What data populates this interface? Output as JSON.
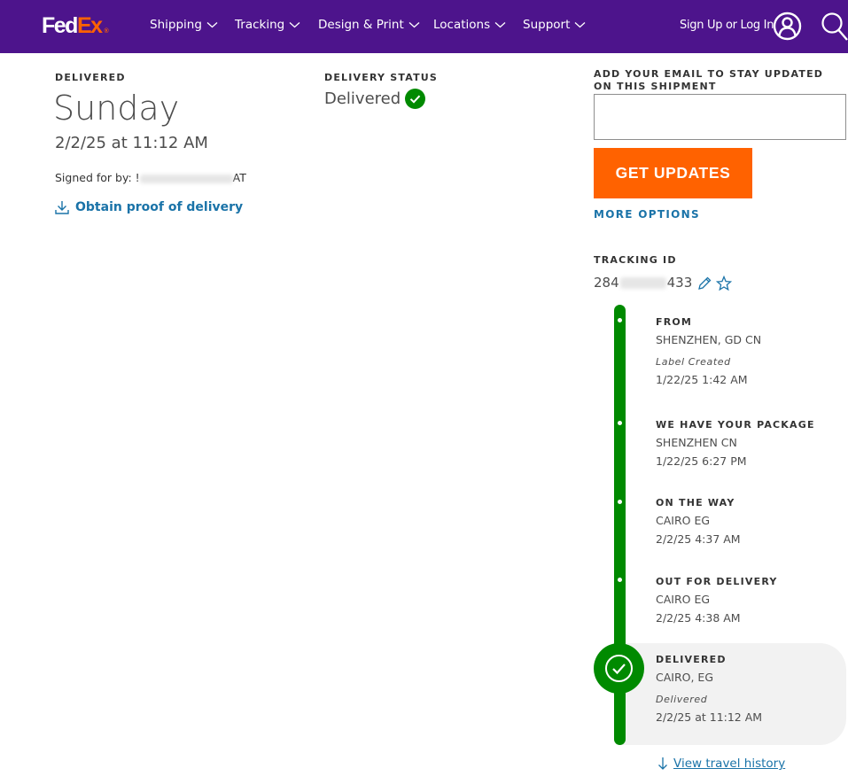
{
  "header": {
    "logo": {
      "part1": "Fed",
      "part2": "Ex",
      "mark": "®"
    },
    "nav": [
      {
        "label": "Shipping",
        "icon": "chevron-down-icon"
      },
      {
        "label": "Tracking",
        "icon": "chevron-down-icon"
      },
      {
        "label": "Design & Print",
        "icon": "chevron-down-icon"
      },
      {
        "label": "Locations",
        "icon": "chevron-down-icon"
      },
      {
        "label": "Support",
        "icon": "chevron-down-icon"
      }
    ],
    "signin_label": "Sign Up or Log In",
    "user_icon": "user-icon",
    "search_icon": "search-icon"
  },
  "delivery": {
    "eyebrow": "DELIVERED",
    "day": "Sunday",
    "datetime": "2/2/25 at 11:12 AM",
    "signed_for_prefix": "Signed for by: !",
    "signed_for_visible_end": "AT",
    "signed_for_redacted": true,
    "proof_link": "Obtain proof of delivery"
  },
  "status": {
    "eyebrow": "DELIVERY STATUS",
    "value": "Delivered"
  },
  "updates": {
    "email_label": "ADD YOUR EMAIL TO STAY UPDATED ON THIS SHIPMENT",
    "email_value": "",
    "email_placeholder": "",
    "button_label": "GET UPDATES",
    "more_options": "MORE OPTIONS"
  },
  "tracking": {
    "eyebrow": "TRACKING ID",
    "id_start": "284",
    "id_end": "433",
    "id_redacted": true
  },
  "timeline": [
    {
      "title": "FROM",
      "location": "SHENZHEN, GD CN",
      "note": "Label Created",
      "time": "1/22/25 1:42 AM"
    },
    {
      "title": "WE HAVE YOUR PACKAGE",
      "location": "SHENZHEN CN",
      "note": "",
      "time": "1/22/25 6:27 PM"
    },
    {
      "title": "ON THE WAY",
      "location": "CAIRO EG",
      "note": "",
      "time": "2/2/25 4:37 AM"
    },
    {
      "title": "OUT FOR DELIVERY",
      "location": "CAIRO EG",
      "note": "",
      "time": "2/2/25 4:38 AM"
    },
    {
      "title": "DELIVERED",
      "location": "CAIRO, EG",
      "note": "Delivered",
      "time": "2/2/25 at 11:12 AM"
    }
  ],
  "travel_history_link": "View travel history",
  "colors": {
    "brand_purple": "#4d148c",
    "brand_orange": "#ff6200",
    "success_green": "#008a00",
    "link_blue": "#1a73a8"
  }
}
